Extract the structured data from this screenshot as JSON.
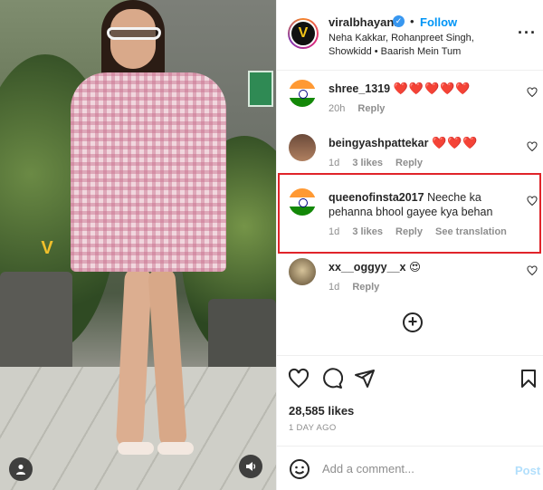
{
  "post": {
    "username": "viralbhayani",
    "follow_label": "Follow",
    "dot": "•",
    "subtitle": "Neha Kakkar, Rohanpreet Singh, Showkidd • Baarish Mein Tum",
    "more": "···",
    "likes": "28,585 likes",
    "posted_ago": "1 DAY AGO"
  },
  "comments": [
    {
      "username": "shree_1319",
      "text": "❤️❤️❤️❤️❤️",
      "age": "20h",
      "likes": "",
      "reply": "Reply",
      "translation": "",
      "avatar": "india-flag"
    },
    {
      "username": "beingyashpattekar",
      "text": "❤️❤️❤️",
      "age": "1d",
      "likes": "3 likes",
      "reply": "Reply",
      "translation": "",
      "avatar": "profile-photo"
    },
    {
      "username": "queenofinsta2017",
      "text": "Neeche ka pehanna bhool gayee kya behan",
      "age": "1d",
      "likes": "3 likes",
      "reply": "Reply",
      "translation": "See translation",
      "avatar": "india-flag"
    },
    {
      "username": "xx__oggyy__x",
      "text": "😍",
      "age": "1d",
      "likes": "",
      "reply": "Reply",
      "translation": "",
      "avatar": "profile-photo"
    }
  ],
  "composer": {
    "placeholder": "Add a comment...",
    "post_label": "Post"
  },
  "colors": {
    "accent": "#0095f6",
    "highlight_box": "#e0242a",
    "heart": "#ed4956",
    "muted": "#8e8e8e"
  },
  "icons": [
    "verified-icon",
    "more-options-icon",
    "heart-icon",
    "comment-icon",
    "share-icon",
    "bookmark-icon",
    "load-more-icon",
    "emoji-icon",
    "user-tag-icon",
    "volume-icon"
  ]
}
